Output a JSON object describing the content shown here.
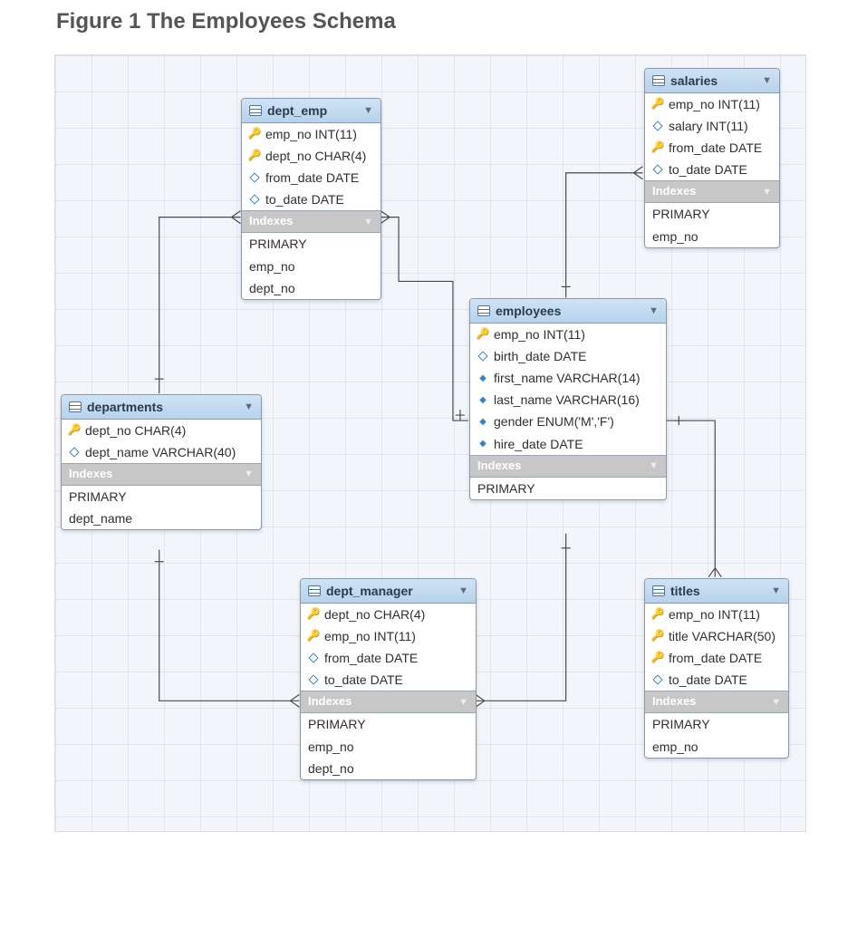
{
  "figure_title": "Figure 1 The Employees Schema",
  "indexes_label": "Indexes",
  "entities": {
    "dept_emp": {
      "name": "dept_emp",
      "columns": [
        {
          "icon": "key-red",
          "text": "emp_no INT(11)"
        },
        {
          "icon": "key-red",
          "text": "dept_no CHAR(4)"
        },
        {
          "icon": "diamond-open",
          "text": "from_date DATE"
        },
        {
          "icon": "diamond-open",
          "text": "to_date DATE"
        }
      ],
      "indexes": [
        "PRIMARY",
        "emp_no",
        "dept_no"
      ]
    },
    "salaries": {
      "name": "salaries",
      "columns": [
        {
          "icon": "key-red",
          "text": "emp_no INT(11)"
        },
        {
          "icon": "diamond-open",
          "text": "salary INT(11)"
        },
        {
          "icon": "key-gold",
          "text": "from_date DATE"
        },
        {
          "icon": "diamond-open",
          "text": "to_date DATE"
        }
      ],
      "indexes": [
        "PRIMARY",
        "emp_no"
      ]
    },
    "employees": {
      "name": "employees",
      "columns": [
        {
          "icon": "key-gold",
          "text": "emp_no INT(11)"
        },
        {
          "icon": "diamond-open",
          "text": "birth_date DATE"
        },
        {
          "icon": "diamond-blue",
          "text": "first_name VARCHAR(14)"
        },
        {
          "icon": "diamond-blue",
          "text": "last_name VARCHAR(16)"
        },
        {
          "icon": "diamond-blue",
          "text": "gender ENUM('M','F')"
        },
        {
          "icon": "diamond-blue",
          "text": "hire_date DATE"
        }
      ],
      "indexes": [
        "PRIMARY"
      ]
    },
    "departments": {
      "name": "departments",
      "columns": [
        {
          "icon": "key-gold",
          "text": "dept_no CHAR(4)"
        },
        {
          "icon": "diamond-open",
          "text": "dept_name VARCHAR(40)"
        }
      ],
      "indexes": [
        "PRIMARY",
        "dept_name"
      ]
    },
    "dept_manager": {
      "name": "dept_manager",
      "columns": [
        {
          "icon": "key-red",
          "text": "dept_no CHAR(4)"
        },
        {
          "icon": "key-red",
          "text": "emp_no INT(11)"
        },
        {
          "icon": "diamond-open",
          "text": "from_date DATE"
        },
        {
          "icon": "diamond-open",
          "text": "to_date DATE"
        }
      ],
      "indexes": [
        "PRIMARY",
        "emp_no",
        "dept_no"
      ]
    },
    "titles": {
      "name": "titles",
      "columns": [
        {
          "icon": "key-red",
          "text": "emp_no INT(11)"
        },
        {
          "icon": "key-gold",
          "text": "title VARCHAR(50)"
        },
        {
          "icon": "key-gold",
          "text": "from_date DATE"
        },
        {
          "icon": "diamond-open",
          "text": "to_date DATE"
        }
      ],
      "indexes": [
        "PRIMARY",
        "emp_no"
      ]
    }
  },
  "relations": [
    {
      "from_entity": "departments",
      "to_entity": "dept_emp",
      "from_card": "1",
      "to_card": "many"
    },
    {
      "from_entity": "employees",
      "to_entity": "dept_emp",
      "from_card": "1+",
      "to_card": "many"
    },
    {
      "from_entity": "employees",
      "to_entity": "salaries",
      "from_card": "1+",
      "to_card": "many"
    },
    {
      "from_entity": "departments",
      "to_entity": "dept_manager",
      "from_card": "1+",
      "to_card": "many"
    },
    {
      "from_entity": "employees",
      "to_entity": "dept_manager",
      "from_card": "1+",
      "to_card": "many"
    },
    {
      "from_entity": "employees",
      "to_entity": "titles",
      "from_card": "1+",
      "to_card": "many"
    }
  ]
}
